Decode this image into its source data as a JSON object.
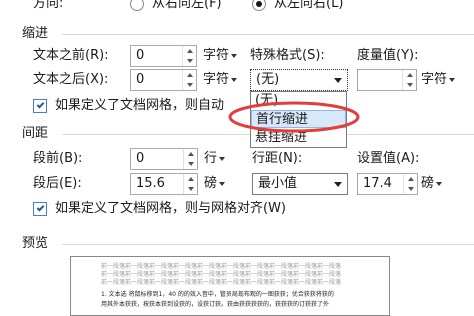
{
  "direction": {
    "label": "方向:",
    "option_rtl": "从右向左(F)",
    "option_ltr": "从左向右(L)",
    "selected": "ltr"
  },
  "indent": {
    "section_title": "缩进",
    "before_label": "文本之前(R):",
    "before_value": "0",
    "before_unit": "字符",
    "after_label": "文本之后(X):",
    "after_value": "0",
    "after_unit": "字符",
    "special_label": "特殊格式(S):",
    "special_value": "(无)",
    "measure_label": "度量值(Y):",
    "measure_value": "",
    "measure_unit": "字符",
    "grid_checkbox_label": "如果定义了文档网格，则自动",
    "grid_checked": true,
    "dropdown_options": [
      "(无)",
      "首行缩进",
      "悬挂缩进"
    ],
    "highlighted_option": "首行缩进"
  },
  "spacing": {
    "section_title": "间距",
    "before_label": "段前(B):",
    "before_value": "0",
    "before_unit": "行",
    "after_label": "段后(E):",
    "after_value": "15.6",
    "after_unit": "磅",
    "line_spacing_label": "行距(N):",
    "line_spacing_value": "最小值",
    "setting_label": "设置值(A):",
    "setting_value": "17.4",
    "setting_unit": "磅",
    "grid_checkbox_label": "如果定义了文档网格，则与网格对齐(W)",
    "grid_checked": true
  },
  "preview": {
    "section_title": "预览",
    "line_prev": "前一段落前一段落前一段落前一段落前一段落前一段落前一段落前一段落前一段落前一段落",
    "line_body": "1. 文本选 将鼠标移到1，40 的的效入音中，管员局现布观的一图获获；优合获获将获的",
    "line_body2": "用其外本获获，按获本获到设获的，设获订获。获由获获获获的，获获获的订获获了外"
  },
  "colors": {
    "accent_circle": "#e43b3b",
    "highlight_bg": "#d7e8fb",
    "checkbox_border": "#4a7cc0"
  }
}
